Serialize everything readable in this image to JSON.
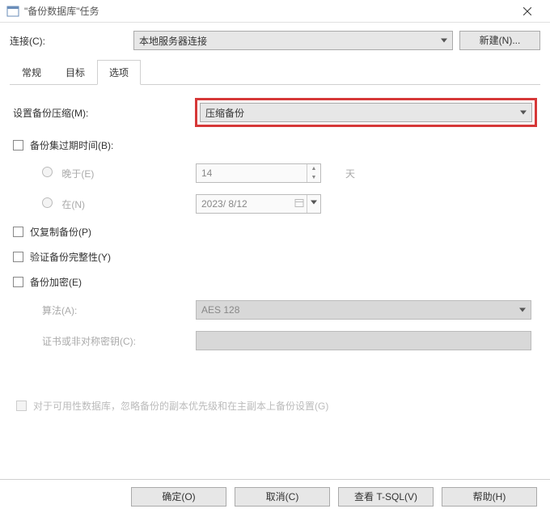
{
  "titlebar": {
    "title": "\"备份数据库\"任务"
  },
  "connection": {
    "label": "连接(C):",
    "value": "本地服务器连接",
    "new_button": "新建(N)..."
  },
  "tabs": {
    "general": "常规",
    "target": "目标",
    "options": "选项"
  },
  "options": {
    "compression": {
      "label": "设置备份压缩(M):",
      "value": "压缩备份"
    },
    "expire": {
      "label": "备份集过期时间(B):",
      "later_than": "晚于(E)",
      "at": "在(N)",
      "days_value": "14",
      "days_unit": "天",
      "date_value": "2023/ 8/12"
    },
    "copy_only": "仅复制备份(P)",
    "verify": "验证备份完整性(Y)",
    "encrypt": {
      "label": "备份加密(E)",
      "algo_label": "算法(A):",
      "algo_value": "AES 128",
      "cert_label": "证书或非对称密钥(C):"
    },
    "availability_note": "对于可用性数据库，忽略备份的副本优先级和在主副本上备份设置(G)"
  },
  "footer": {
    "ok": "确定(O)",
    "cancel": "取消(C)",
    "view_tsql": "查看 T-SQL(V)",
    "help": "帮助(H)"
  }
}
